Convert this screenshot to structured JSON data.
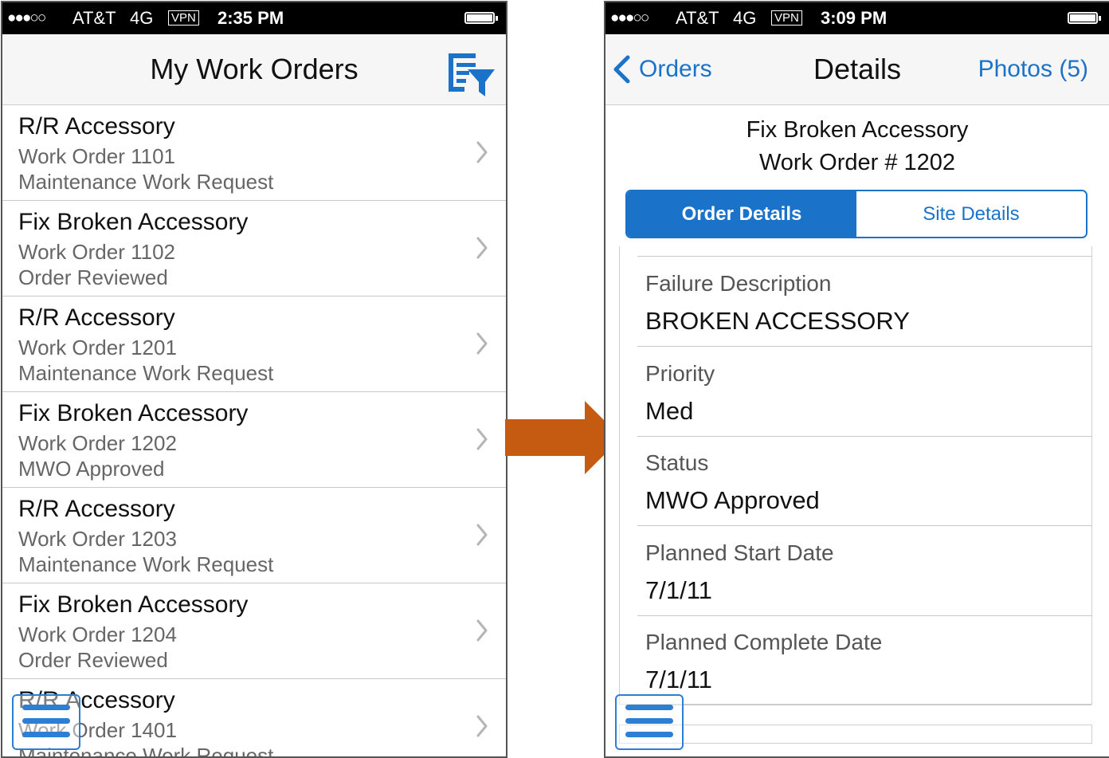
{
  "colors": {
    "ios_blue": "#1a73c8",
    "arrow": "#c55a11",
    "menu_icon": "#2d7fd6"
  },
  "left_screen": {
    "status_bar": {
      "signal": "●●●○○",
      "carrier": "AT&T",
      "network": "4G",
      "vpn": "VPN",
      "time": "2:35 PM"
    },
    "title": "My Work Orders",
    "filter_icon": "filter-list-icon",
    "orders": [
      {
        "title": "R/R Accessory",
        "number": "Work Order 1101",
        "status": "Maintenance Work Request"
      },
      {
        "title": "Fix Broken Accessory",
        "number": "Work Order 1102",
        "status": "Order Reviewed"
      },
      {
        "title": "R/R Accessory",
        "number": "Work Order 1201",
        "status": "Maintenance Work Request"
      },
      {
        "title": "Fix Broken Accessory",
        "number": "Work Order 1202",
        "status": "MWO Approved"
      },
      {
        "title": "R/R Accessory",
        "number": "Work Order 1203",
        "status": "Maintenance Work Request"
      },
      {
        "title": "Fix Broken Accessory",
        "number": "Work Order 1204",
        "status": "Order Reviewed"
      },
      {
        "title": "R/R Accessory",
        "number": "Work Order 1401",
        "status": "Maintenance Work Request"
      }
    ],
    "menu_icon": "hamburger-menu-icon"
  },
  "transition_arrow": "right-arrow",
  "right_screen": {
    "status_bar": {
      "signal": "●●●○○",
      "carrier": "AT&T",
      "network": "4G",
      "vpn": "VPN",
      "time": "3:09 PM"
    },
    "back_label": "Orders",
    "title": "Details",
    "photos_label": "Photos (5)",
    "order_title": "Fix Broken Accessory",
    "order_number": "Work Order # 1202",
    "tabs": [
      {
        "label": "Order Details",
        "active": true
      },
      {
        "label": "Site Details",
        "active": false
      }
    ],
    "fields": [
      {
        "label": "Failure Description",
        "value": "BROKEN ACCESSORY"
      },
      {
        "label": "Priority",
        "value": "Med"
      },
      {
        "label": "Status",
        "value": "MWO Approved"
      },
      {
        "label": "Planned Start Date",
        "value": "7/1/11"
      },
      {
        "label": "Planned Complete Date",
        "value": "7/1/11"
      }
    ],
    "menu_icon": "hamburger-menu-icon"
  }
}
